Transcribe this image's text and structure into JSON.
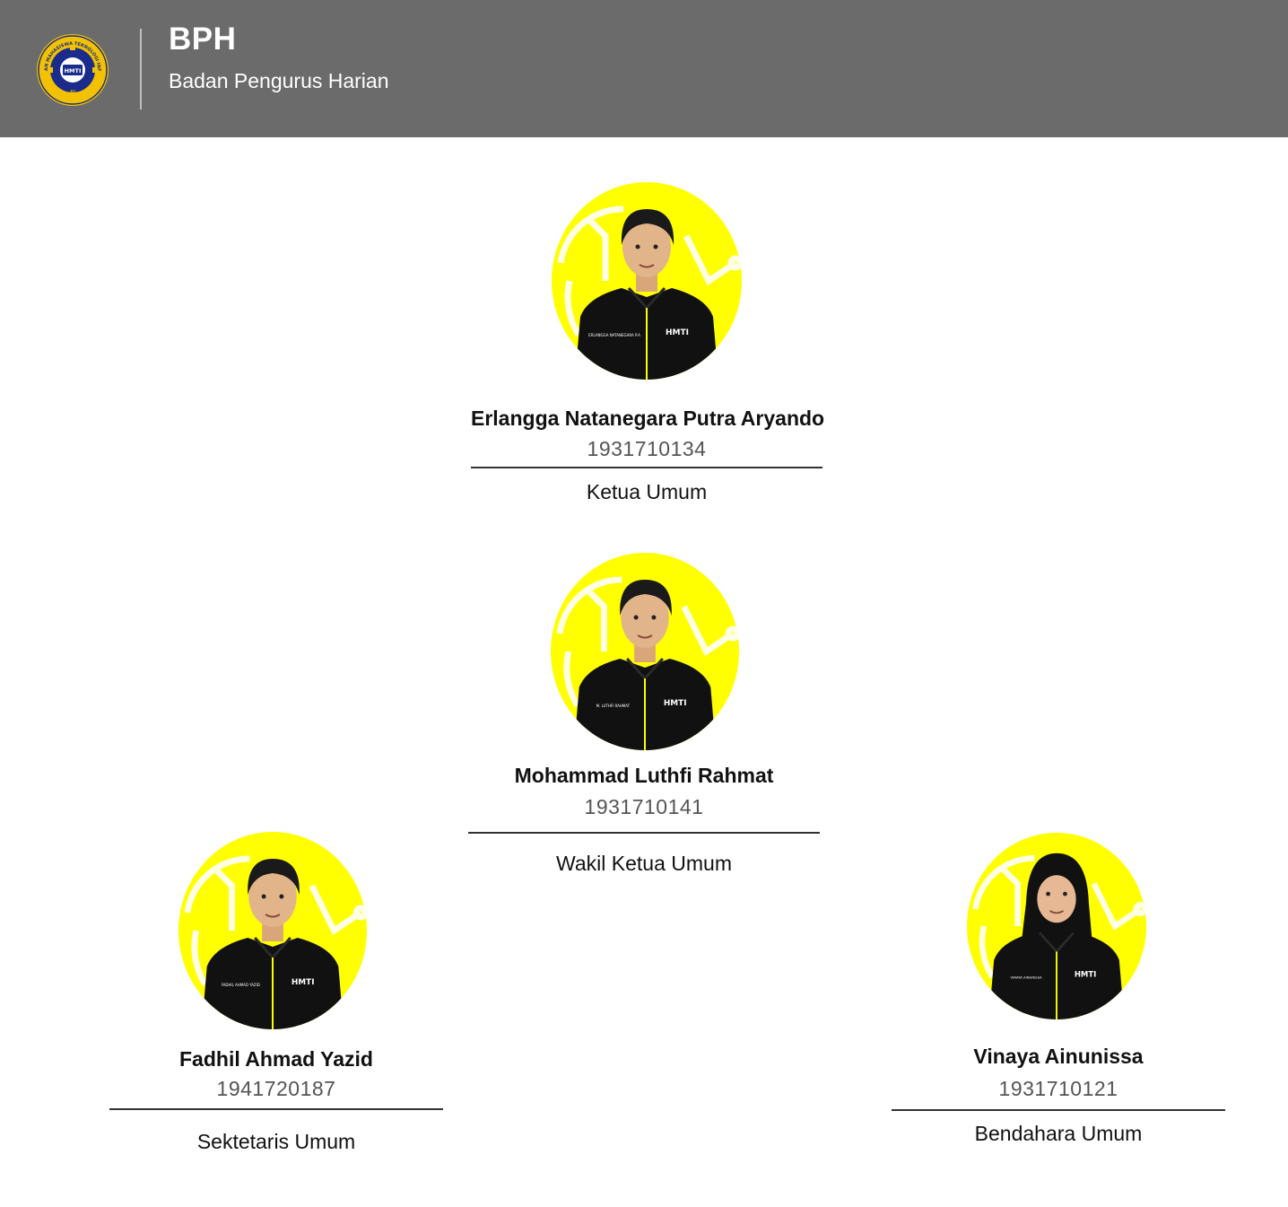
{
  "header": {
    "logo_icon": "hmti-polinema-logo-icon",
    "logo_ring_text_top": "HIMPUNAN MAHASISWA TEKNOLOGI INFORMASI",
    "logo_ring_text_bottom": "POLINEMA",
    "logo_center_text": "HMTI",
    "title": "BPH",
    "subtitle": "Badan Pengurus Harian"
  },
  "colors": {
    "header_bg": "#6b6b6b",
    "photo_bg": "#ffff00",
    "shirt": "#111111"
  },
  "members": [
    {
      "name": "Erlangga Natanegara Putra Aryando",
      "nim": "1931710134",
      "role": "Ketua Umum",
      "shirt_label": "HMTI",
      "name_tag": "ERLANGGA NATANEGARA P.A",
      "hijab": false
    },
    {
      "name": "Mohammad Luthfi Rahmat",
      "nim": "1931710141",
      "role": "Wakil Ketua Umum",
      "shirt_label": "HMTI",
      "name_tag": "M. LUTHFI RAHMAT",
      "hijab": false
    },
    {
      "name": "Fadhil Ahmad Yazid",
      "nim": "1941720187",
      "role": "Sektetaris Umum",
      "shirt_label": "HMTI",
      "name_tag": "FADHIL AHMAD YAZID",
      "hijab": false
    },
    {
      "name": "Vinaya Ainunissa",
      "nim": "1931710121",
      "role": "Bendahara Umum",
      "shirt_label": "HMTI",
      "name_tag": "VINAYA AINUNISSA",
      "hijab": true
    }
  ]
}
